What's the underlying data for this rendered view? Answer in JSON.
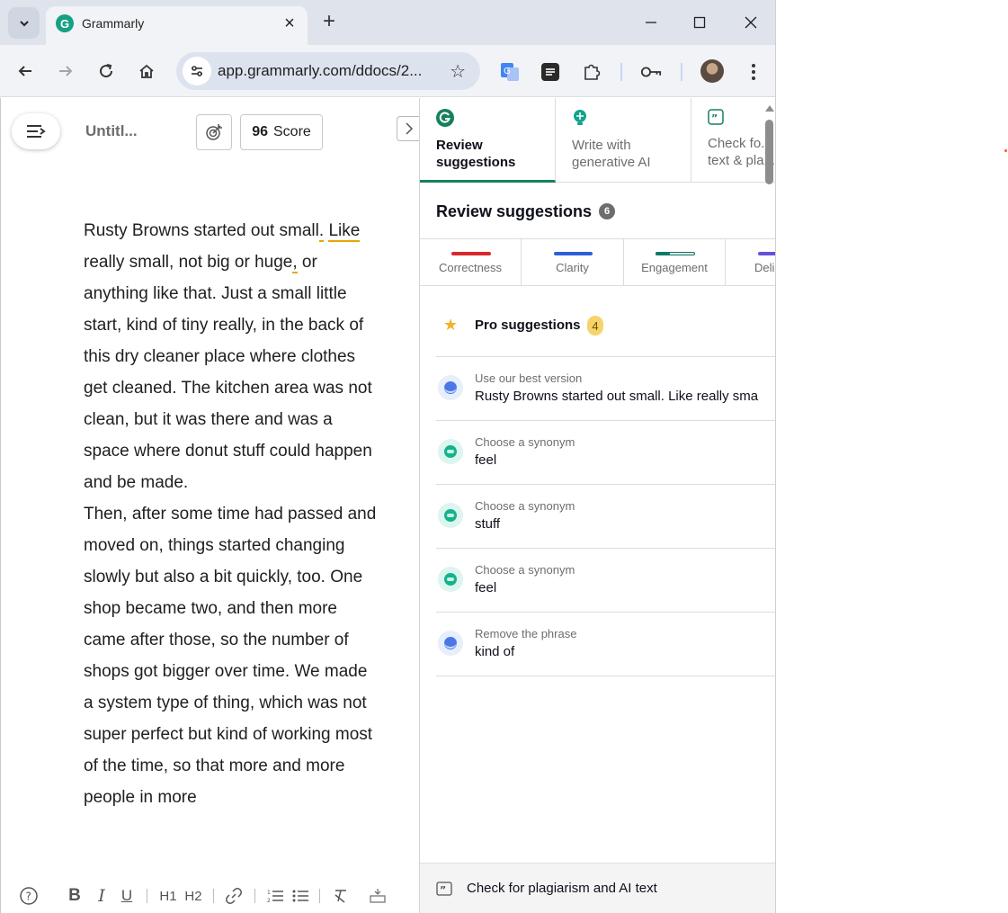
{
  "browser": {
    "tab_title": "Grammarly",
    "url": "app.grammarly.com/ddocs/2...",
    "favicon_letter": "G"
  },
  "editor": {
    "doc_title": "Untitl...",
    "score_value": "96",
    "score_label": "Score",
    "paragraphs": [
      {
        "segments": [
          {
            "text": "Rusty Browns started out small",
            "underline": false
          },
          {
            "text": ".",
            "underline": true
          },
          {
            "text": " ",
            "underline": false
          },
          {
            "text": "Like",
            "underline": true
          },
          {
            "text": " really small, not big or huge",
            "underline": false
          },
          {
            "text": ",",
            "underline": true
          },
          {
            "text": " or anything like that. Just a small little start, kind of tiny really, in the back of this dry cleaner place where clothes get cleaned. The kitchen area was not clean, but it was there and was a space where donut stuff could happen and be made.",
            "underline": false
          }
        ]
      },
      {
        "segments": [
          {
            "text": "Then, after some time had passed and moved on, things started changing slowly but also a bit quickly, too. One shop became two, and then more came after those, so the number of shops got bigger over time. We made a system type of thing, which was not super perfect but kind of working most of the time, so that more and more people in more",
            "underline": false
          }
        ]
      }
    ]
  },
  "sidebar": {
    "tabs": [
      {
        "label_line1": "Review",
        "label_line2": "suggestions",
        "icon": "grammarly-g-icon",
        "active": true
      },
      {
        "label_line1": "Write with",
        "label_line2": "generative AI",
        "icon": "lightbulb-sparkle-icon",
        "active": false
      },
      {
        "label_line1": "Check fo...",
        "label_line2": "text & pla...",
        "icon": "quote-icon",
        "active": false
      }
    ],
    "review_title": "Review suggestions",
    "review_count": "6",
    "categories": [
      {
        "label": "Correctness",
        "color": "#d8282c"
      },
      {
        "label": "Clarity",
        "color": "#2d5fd8"
      },
      {
        "label": "Engagement",
        "color": "#0f7a68"
      },
      {
        "label": "Deli",
        "color": "#6a4fd8"
      }
    ],
    "pro_label": "Pro suggestions",
    "pro_count": "4",
    "suggestions": [
      {
        "caption": "Use our best version",
        "text": "Rusty Browns started out small. Like really sma",
        "icon": "clarity-blue-icon"
      },
      {
        "caption": "Choose a synonym",
        "text": "feel",
        "icon": "engagement-green-icon"
      },
      {
        "caption": "Choose a synonym",
        "text": "stuff",
        "icon": "engagement-green-icon"
      },
      {
        "caption": "Choose a synonym",
        "text": "feel",
        "icon": "engagement-green-icon"
      },
      {
        "caption": "Remove the phrase",
        "text": "kind of",
        "icon": "clarity-blue-icon"
      }
    ],
    "cta_label": "Check for plagiarism and AI text"
  },
  "colors": {
    "grammarly_green": "#15805e",
    "underline_yellow": "#e8a400"
  }
}
